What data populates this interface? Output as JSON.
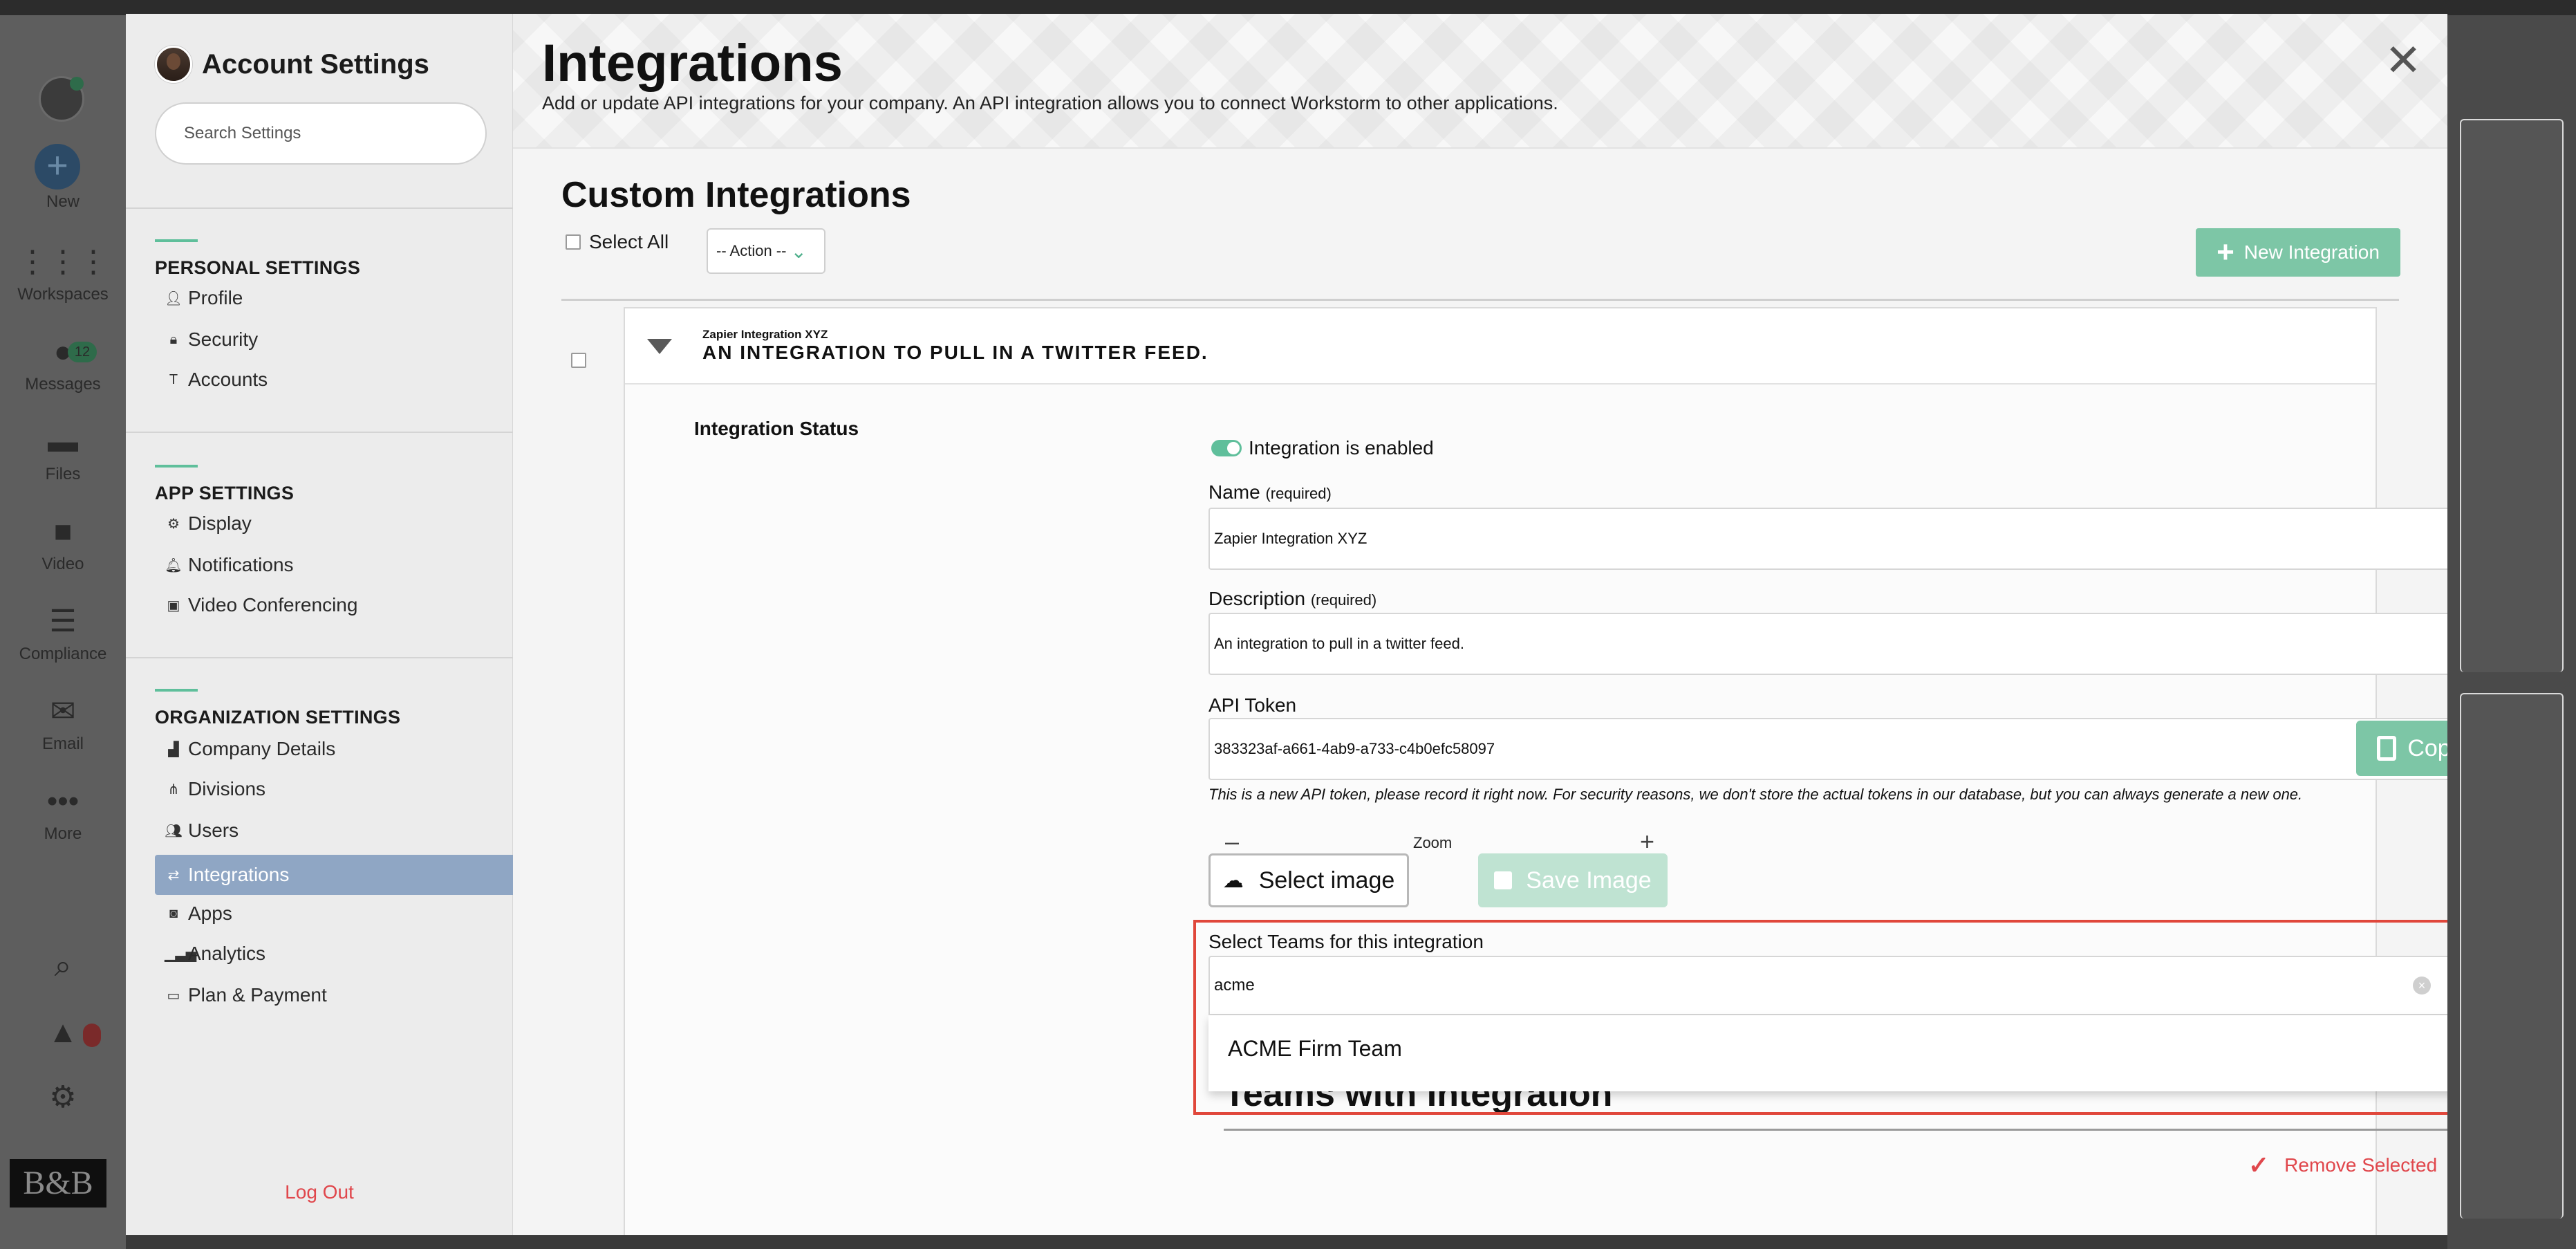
{
  "rail": {
    "new_label": "New",
    "items": [
      {
        "label": "Workspaces",
        "icon": "grid-icon"
      },
      {
        "label": "Messages",
        "icon": "chat-icon",
        "badge": "12"
      },
      {
        "label": "Files",
        "icon": "folder-icon"
      },
      {
        "label": "Video",
        "icon": "video-icon"
      },
      {
        "label": "Compliance",
        "icon": "list-icon"
      },
      {
        "label": "Email",
        "icon": "mail-icon"
      },
      {
        "label": "More",
        "icon": "ellipsis-icon"
      }
    ],
    "logo_text": "B&B"
  },
  "sidebar": {
    "title": "Account Settings",
    "search_placeholder": "Search Settings",
    "sections": [
      {
        "title": "PERSONAL SETTINGS",
        "items": [
          "Profile",
          "Security",
          "Accounts"
        ]
      },
      {
        "title": "APP SETTINGS",
        "items": [
          "Display",
          "Notifications",
          "Video Conferencing"
        ]
      },
      {
        "title": "ORGANIZATION SETTINGS",
        "items": [
          "Company Details",
          "Divisions",
          "Users",
          "Integrations",
          "Apps",
          "Analytics",
          "Plan & Payment"
        ]
      }
    ],
    "active_item": "Integrations",
    "logout": "Log Out"
  },
  "header": {
    "title": "Integrations",
    "subtitle": "Add or update API integrations for your company. An API integration allows you to connect Workstorm to other applications.",
    "close": "✕"
  },
  "custom": {
    "title": "Custom Integrations",
    "select_all": "Select All",
    "action_label": "-- Action --",
    "new_button": "New Integration"
  },
  "integration": {
    "name_small": "Zapier Integration XYZ",
    "desc_caps": "AN INTEGRATION TO PULL IN A TWITTER FEED.",
    "status_label": "Integration Status",
    "status_value": "Integration is enabled",
    "name_label": "Name",
    "required": "(required)",
    "name_value": "Zapier Integration XYZ",
    "desc_label": "Description",
    "desc_value": "An integration to pull in a twitter feed.",
    "token_label": "API Token",
    "token_value": "383323af-a661-4ab9-a733-c4b0efc58097",
    "copy": "Copy",
    "token_note": "This is a new API token, please record it right now. For security reasons, we don't store the actual tokens in our database, but you can always generate a new one.",
    "zoom_minus": "–",
    "zoom_label": "Zoom",
    "zoom_plus": "+",
    "select_image": "Select image",
    "save_image": "Save Image",
    "teams_label": "Select Teams for this integration",
    "teams_query": "acme",
    "dropdown_option": "ACME Firm Team",
    "teams_with": "Teams with Integration",
    "remove_selected": "Remove Selected"
  },
  "colors": {
    "accent_green": "#5fbf9b",
    "button_green": "#7dc6a6",
    "active_blue": "#8fa6c4",
    "danger_red": "#e0474c",
    "highlight_red": "#e0473b"
  }
}
